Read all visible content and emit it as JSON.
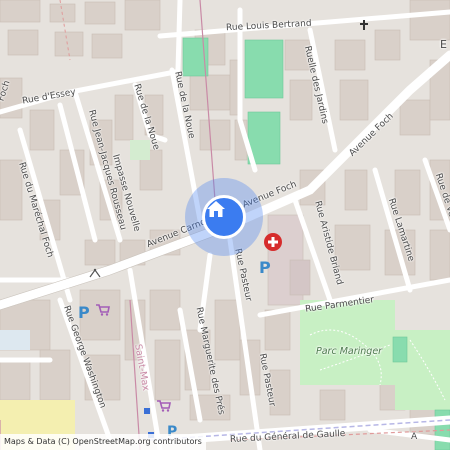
{
  "colors": {
    "background": "#e6e2dd",
    "building": "#d9d0c9",
    "building_stroke": "#c8bdb5",
    "road": "#ffffff",
    "road_main": "#ffffff",
    "park": "#c8f0c4",
    "pitch": "#88dcae",
    "marker": "#3b7cf0",
    "hospital": "#d62c2c",
    "parking": "#3a89c9",
    "shop": "#a35db7",
    "rail": "#c98aa6"
  },
  "streets": {
    "rue_louis_bertrand": "Rue Louis Bertrand",
    "rue_d_essey": "Rue d'Essey",
    "foch_top_left": "Foch",
    "rue_de_la_noue_1": "Rue de la Noue",
    "rue_de_la_noue_2": "Rue de la Noue",
    "ruelle_des_jardins": "Ruelle des Jardins",
    "avenue_foch_1": "Avenue Foch",
    "avenue_foch_2": "Avenue Foch",
    "rue_jean_jacques_rousseau": "Rue Jean-Jacques Rousseau",
    "impasse_nouvelle": "Impasse Nouvelle",
    "rue_du_marechal_foch": "Rue du Maréchal Foch",
    "avenue_carnot": "Avenue Carnot",
    "rue_pasteur_1": "Rue Pasteur",
    "rue_pasteur_2": "Rue Pasteur",
    "rue_aristide_briand": "Rue Aristide Briand",
    "rue_lamartine": "Rue Lamartine",
    "rue_de_verdun": "Rue de Verdun",
    "rue_parmentier": "Rue Parmentier",
    "parc_maringer": "Parc Maringer",
    "rue_marguerite_des_pres": "Rue Marguerite des Prés",
    "rue_george_washington": "Rue George Washington",
    "saint_max": "Saint-Max",
    "rue_du_general_de_gaulle": "Rue du Général de Gaulle",
    "edge_top_right": "E",
    "edge_bottom_right": "A"
  },
  "attribution": "Maps & Data (C) OpenStreetMap.org contributors",
  "icons": {
    "location_marker": "home-icon",
    "hospital": "hospital-cross-icon",
    "parking": "parking-icon",
    "shop": "shopping-cart-icon",
    "church": "cross-icon",
    "viewpoint": "viewpoint-icon"
  },
  "poi_text": {
    "parking_glyph": "P"
  }
}
